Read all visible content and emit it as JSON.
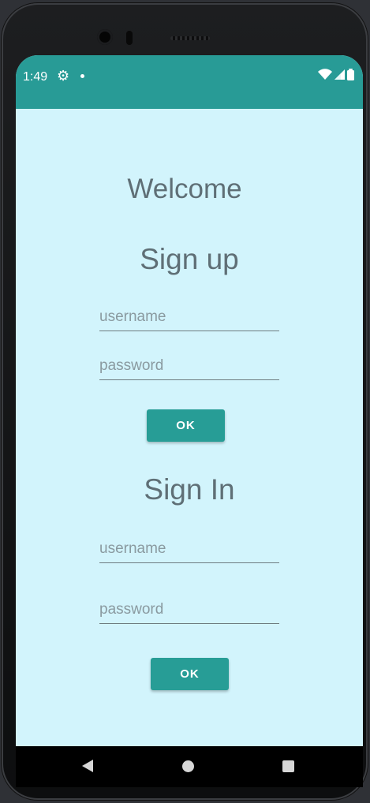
{
  "status_bar": {
    "time": "1:49",
    "settings_icon": "gear-icon",
    "dot_icon": "notification-dot-icon",
    "wifi_icon": "wifi-icon",
    "signal_icon": "cell-signal-icon",
    "battery_icon": "battery-icon",
    "color": "#289b96"
  },
  "main": {
    "welcome": "Welcome",
    "sign_up": {
      "title": "Sign up",
      "username_placeholder": "username",
      "password_placeholder": "password",
      "ok_label": "OK"
    },
    "sign_in": {
      "title": "Sign In",
      "username_placeholder": "username",
      "password_placeholder": "password",
      "ok_label": "OK"
    },
    "background_color": "#d2f4fc",
    "accent_color": "#279d96"
  },
  "nav_bar": {
    "back_icon": "back-triangle-icon",
    "home_icon": "home-circle-icon",
    "recents_icon": "recents-square-icon"
  }
}
